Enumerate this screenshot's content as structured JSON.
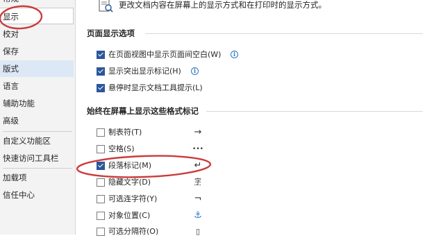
{
  "sidebar": {
    "items": [
      {
        "label": "常规"
      },
      {
        "label": "显示"
      },
      {
        "label": "校对"
      },
      {
        "label": "保存"
      },
      {
        "label": "版式"
      },
      {
        "label": "语言"
      },
      {
        "label": "辅助功能"
      },
      {
        "label": "高级"
      },
      {
        "label": "自定义功能区"
      },
      {
        "label": "快速访问工具栏"
      },
      {
        "label": "加载项"
      },
      {
        "label": "信任中心"
      }
    ],
    "selected": "显示"
  },
  "header": {
    "description": "更改文档内容在屏幕上的显示方式和在打印时的显示方式。"
  },
  "page_display": {
    "title": "页面显示选项",
    "options": [
      {
        "label": "在页面视图中显示页面间空白(W)",
        "checked": true,
        "info": "i"
      },
      {
        "label": "显示突出显示标记(H)",
        "checked": true,
        "info": "i"
      },
      {
        "label": "悬停时显示文档工具提示(L)",
        "checked": true
      }
    ]
  },
  "format_marks": {
    "title": "始终在屏幕上显示这些格式标记",
    "options": [
      {
        "label": "制表符(T)",
        "checked": false,
        "symbol": "→"
      },
      {
        "label": "空格(S)",
        "checked": false,
        "symbol": "•••"
      },
      {
        "label": "段落标记(M)",
        "checked": true,
        "symbol": "↵"
      },
      {
        "label": "隐藏文字(D)",
        "checked": false,
        "symbol": "字"
      },
      {
        "label": "可选连字符(Y)",
        "checked": false,
        "symbol": "¬"
      },
      {
        "label": "对象位置(C)",
        "checked": false,
        "symbol": "⚓"
      },
      {
        "label": "可选分隔符(O)",
        "checked": false,
        "symbol": "▯"
      }
    ]
  },
  "colors": {
    "accent": "#2b579a",
    "annotation": "#cc3b3b",
    "sidebar_bg": "#f3f3f3",
    "highlight_bg": "#dde8f6"
  }
}
